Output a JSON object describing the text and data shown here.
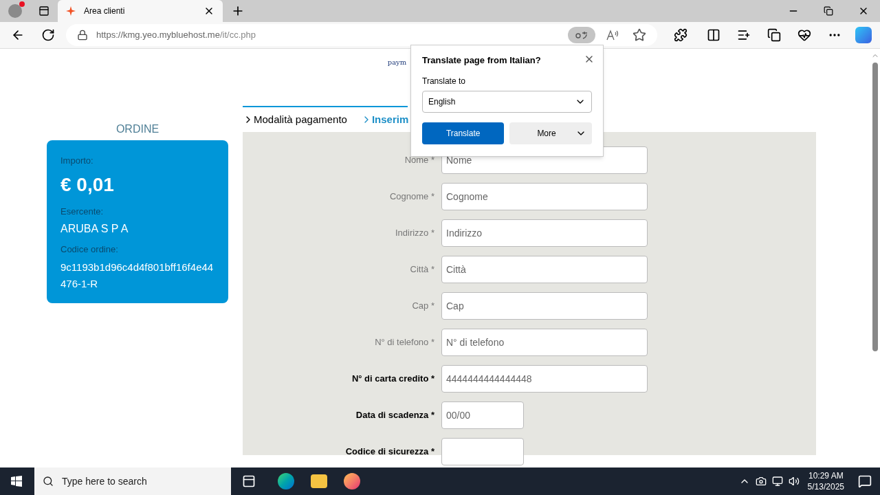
{
  "browser": {
    "tabs": [
      {
        "title": "Area clienti",
        "selected": true
      }
    ],
    "url": {
      "host": "https://kmg.yeo.mybluehost.me",
      "path": "/it/cc.php"
    }
  },
  "page": {
    "header_text": "paym",
    "order": {
      "title": "ORDINE",
      "amount_label": "Importo:",
      "amount": "€ 0,01",
      "merchant_label": "Esercente:",
      "merchant": "ARUBA S P A",
      "code_label": "Codice ordine:",
      "code": "9c1193b1d96c4d4f801bff16f4e44476-1-R"
    },
    "steps": [
      {
        "label": "Modalità pagamento",
        "selected": false
      },
      {
        "label": "Inserim",
        "selected": true
      }
    ],
    "fields": [
      {
        "label": "Nome *",
        "placeholder": "Nome",
        "bold": false,
        "kind": "long"
      },
      {
        "label": "Cognome *",
        "placeholder": "Cognome",
        "bold": false,
        "kind": "long"
      },
      {
        "label": "Indirizzo *",
        "placeholder": "Indirizzo",
        "bold": false,
        "kind": "long"
      },
      {
        "label": "Città *",
        "placeholder": "Città",
        "bold": false,
        "kind": "long"
      },
      {
        "label": "Cap *",
        "placeholder": "Cap",
        "bold": false,
        "kind": "long"
      },
      {
        "label": "N° di telefono *",
        "placeholder": "N° di telefono",
        "bold": false,
        "kind": "long"
      },
      {
        "label": "N° di carta credito *",
        "placeholder": "4444444444444448",
        "bold": true,
        "kind": "long"
      },
      {
        "label": "Data di scadenza *",
        "placeholder": "00/00",
        "bold": true,
        "kind": "short"
      },
      {
        "label": "Codice di sicurezza *",
        "bold": true,
        "kind": "short"
      }
    ]
  },
  "translate_popup": {
    "title": "Translate page from Italian?",
    "to_label": "Translate to",
    "language": "English",
    "primary_button": "Translate",
    "secondary_button": "More"
  },
  "taskbar": {
    "search_placeholder": "Type here to search",
    "time": "10:29 AM",
    "date": "5/13/2025"
  }
}
